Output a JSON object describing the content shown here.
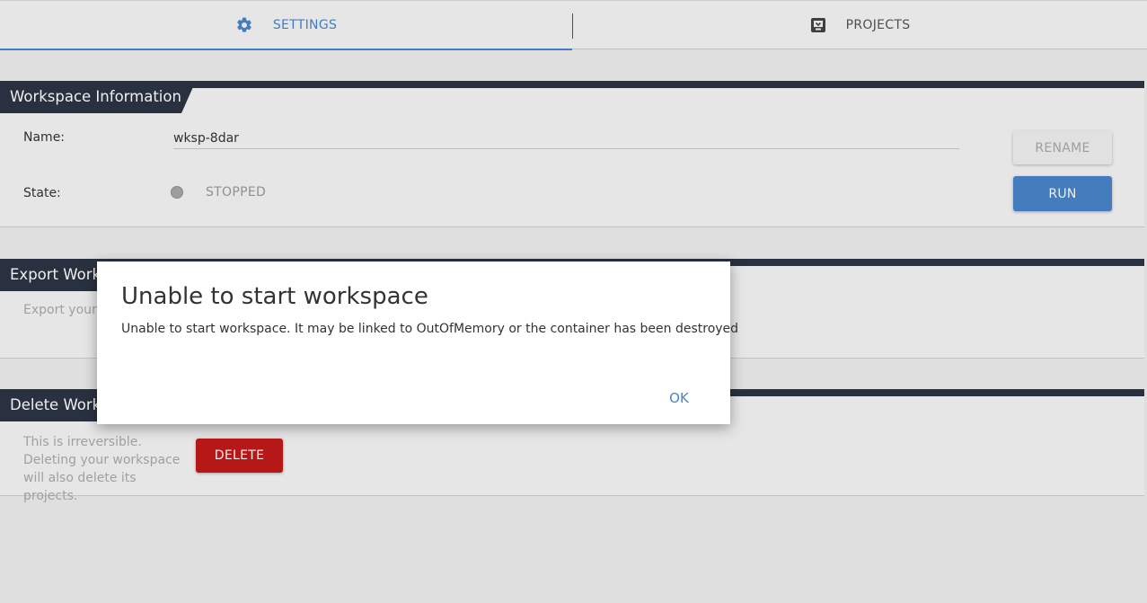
{
  "tabs": {
    "settings": {
      "label": "SETTINGS",
      "icon": "gear-icon",
      "active": true
    },
    "projects": {
      "label": "PROJECTS",
      "icon": "projects-icon",
      "active": false
    }
  },
  "workspace_info": {
    "title": "Workspace Information",
    "name_label": "Name:",
    "name_value": "wksp-8dar",
    "state_label": "State:",
    "state_value": "STOPPED",
    "rename_label": "RENAME",
    "run_label": "RUN"
  },
  "export": {
    "title": "Export Work",
    "text": "Export your"
  },
  "delete": {
    "title": "Delete Work",
    "line1": "This is irreversible.",
    "line2": "Deleting your workspace",
    "line3": "will also delete its projects.",
    "button_label": "DELETE"
  },
  "dialog": {
    "title": "Unable to start workspace",
    "message": "Unable to start workspace. It may be linked to OutOfMemory or the container has been destroyed",
    "ok_label": "OK"
  },
  "colors": {
    "accent": "#4a84c9",
    "section_header": "#2c3443",
    "danger": "#c21a1a"
  }
}
